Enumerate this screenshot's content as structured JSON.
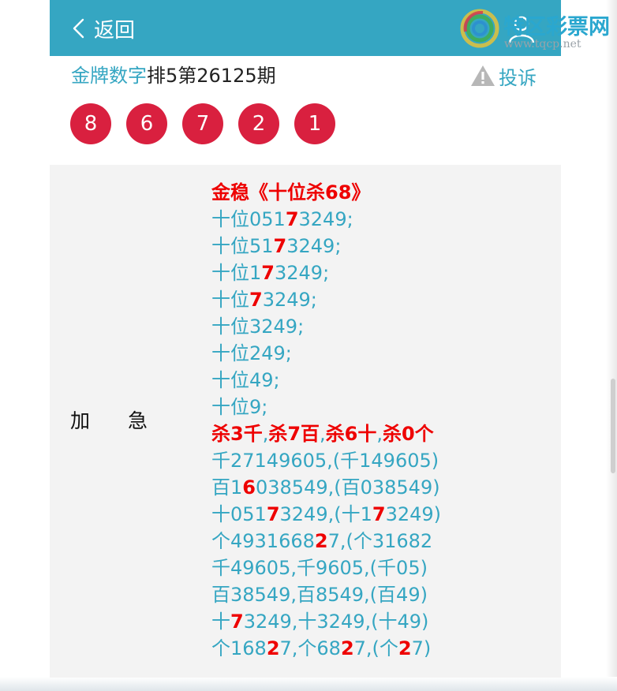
{
  "header": {
    "back_label": "返回"
  },
  "logo": {
    "name": "特区彩票网",
    "url": "www.tqcp.net"
  },
  "title": {
    "brand": "金牌数字",
    "rest": "排5第26125期"
  },
  "complain_label": "投诉",
  "balls": [
    "8",
    "6",
    "7",
    "2",
    "1"
  ],
  "row_label": {
    "c1": "加",
    "c2": "急"
  },
  "lines": [
    {
      "type": "hd",
      "parts": [
        "金稳《十位杀68》"
      ]
    },
    {
      "pre": "十位051",
      "red": "7",
      "post": "3249;"
    },
    {
      "pre": "十位51",
      "red": "7",
      "post": "3249;"
    },
    {
      "pre": "十位1",
      "red": "7",
      "post": "3249;"
    },
    {
      "pre": "十位",
      "red": "7",
      "post": "3249;"
    },
    {
      "pre": "十位3249;"
    },
    {
      "pre": "十位249;"
    },
    {
      "pre": "十位49;"
    },
    {
      "pre": "十位9;"
    },
    {
      "type": "kill",
      "k1": "杀3千",
      "k2": "杀7百",
      "k3": "杀6十",
      "k4": "杀0个",
      "sep": ","
    },
    {
      "pre": "千27149605,(千149605)"
    },
    {
      "pre": "百1",
      "red": "6",
      "post": "038549,(百038549)"
    },
    {
      "pre": "十051",
      "red": "7",
      "post": "3249,(十1",
      "red2": "7",
      "post2": "3249)"
    },
    {
      "pre": "个4931668",
      "red": "2",
      "post": "7,(个31682",
      "red2": "",
      "post2": ""
    },
    {
      "pre": "千49605,千9605,(千05)"
    },
    {
      "pre": "百38549,百8549,(百49)"
    },
    {
      "pre": "十",
      "red": "7",
      "post": "3249,十3249,(十49)"
    },
    {
      "pre": "个168",
      "red": "2",
      "post": "7,个68",
      "red2": "2",
      "post2": "7,(个",
      "red3": "2",
      "post3": "7)"
    }
  ]
}
